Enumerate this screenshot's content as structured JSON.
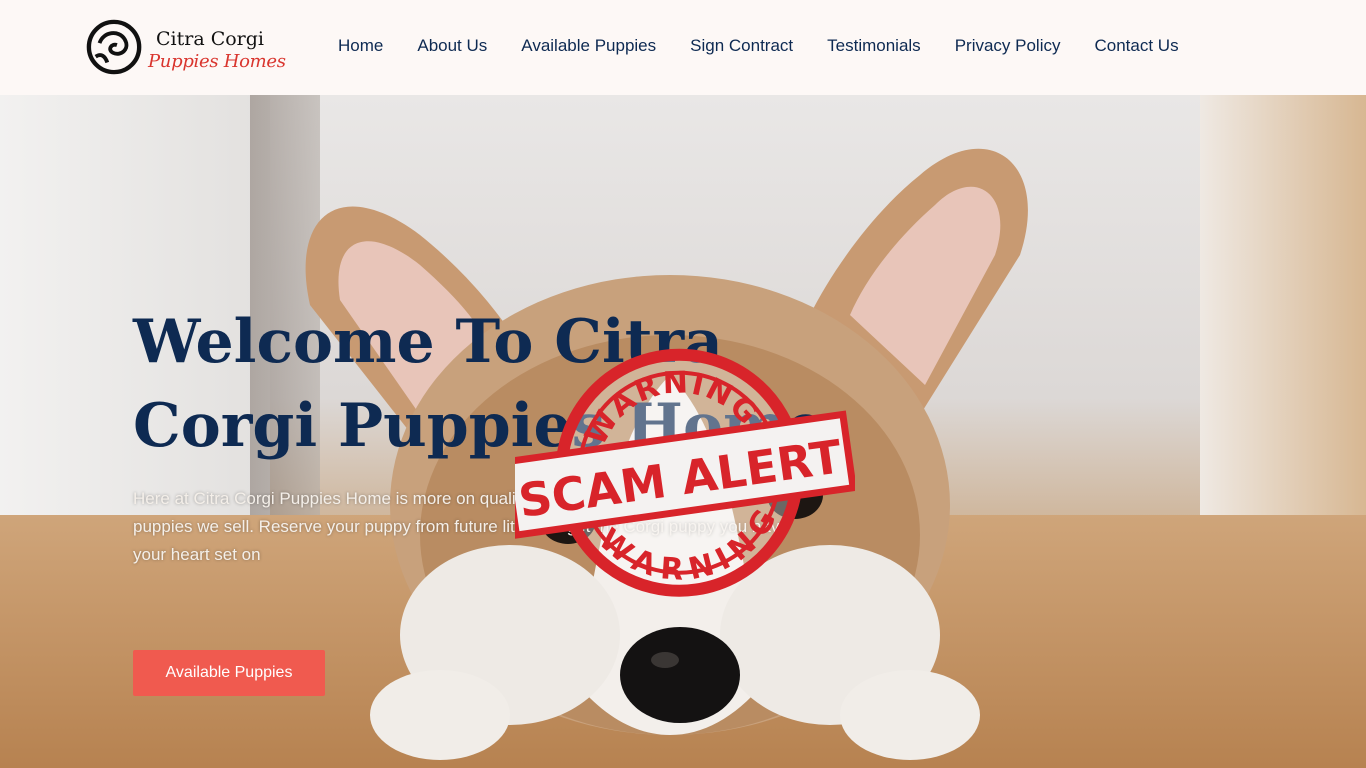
{
  "brand": {
    "name_line1": "Citra Corgi",
    "name_line2": "Puppies Homes"
  },
  "nav": {
    "items": [
      {
        "label": "Home"
      },
      {
        "label": "About Us"
      },
      {
        "label": "Available Puppies"
      },
      {
        "label": "Sign Contract"
      },
      {
        "label": "Testimonials"
      },
      {
        "label": "Privacy Policy"
      },
      {
        "label": "Contact Us"
      }
    ]
  },
  "hero": {
    "title": "Welcome To Citra Corgi Puppies Home",
    "text": "Here at Citra Corgi Puppies Home is more on quality and health than how many puppies we sell. Reserve your puppy from future litters to get the Corgi puppy you have your heart set on",
    "button_label": "Available Puppies"
  },
  "stamp": {
    "top": "WARNING",
    "middle": "SCAM ALERT",
    "bottom": "WARNING",
    "color": "#d8242a"
  },
  "colors": {
    "nav_text": "#0e2a52",
    "accent": "#f05a4f",
    "logo_red": "#d9352e"
  }
}
